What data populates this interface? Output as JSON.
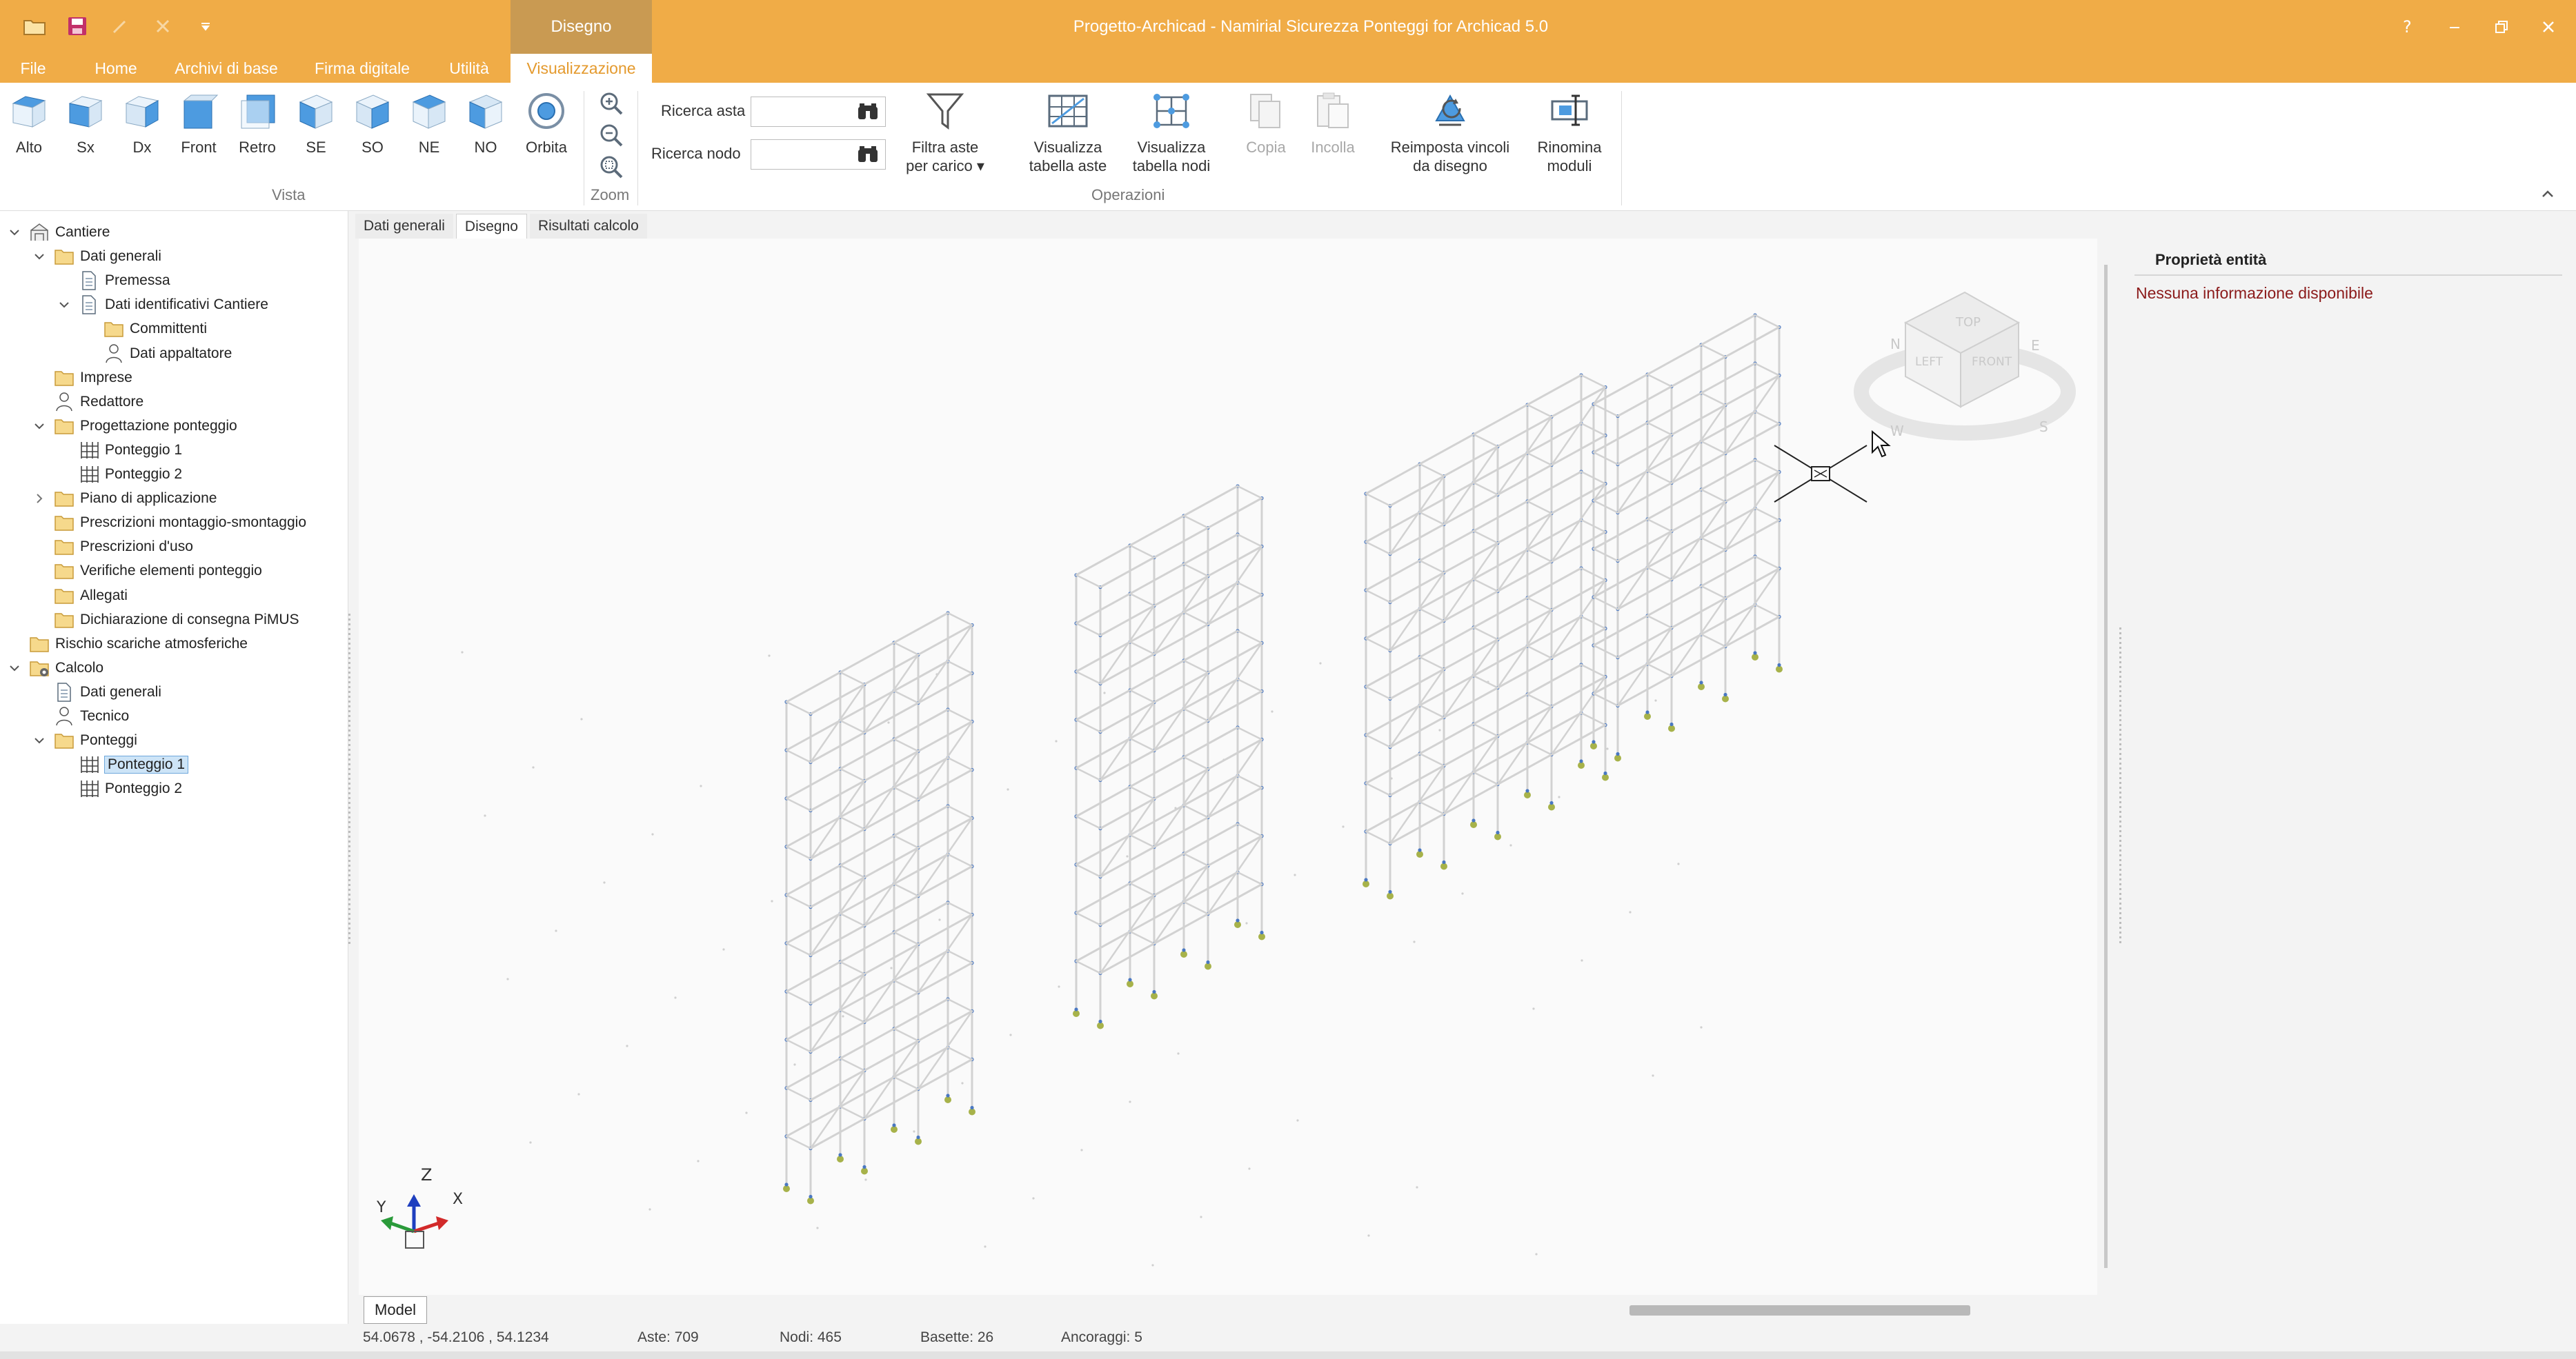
{
  "window": {
    "title": "Progetto-Archicad - Namirial Sicurezza Ponteggi for Archicad 5.0",
    "context_tab": "Disegno",
    "controls": [
      "?",
      "–",
      "❐",
      "✕"
    ]
  },
  "menu": {
    "tabs": [
      {
        "label": "File"
      },
      {
        "label": "Home"
      },
      {
        "label": "Archivi di base"
      },
      {
        "label": "Firma digitale"
      },
      {
        "label": "Utilità"
      },
      {
        "label": "Visualizzazione",
        "active": true
      }
    ]
  },
  "ribbon": {
    "vista": {
      "group_label": "Vista",
      "buttons": [
        "Alto",
        "Sx",
        "Dx",
        "Front",
        "Retro",
        "SE",
        "SO",
        "NE",
        "NO",
        "Orbita"
      ]
    },
    "zoom": {
      "group_label": "Zoom"
    },
    "operazioni": {
      "group_label": "Operazioni",
      "ricerca_asta": "Ricerca asta",
      "ricerca_nodo": "Ricerca nodo",
      "filtra": [
        "Filtra aste",
        "per carico ▾"
      ],
      "vis_aste": [
        "Visualizza",
        "tabella aste"
      ],
      "vis_nodi": [
        "Visualizza",
        "tabella nodi"
      ],
      "copia": "Copia",
      "incolla": "Incolla",
      "reimposta": [
        "Reimposta vincoli",
        "da disegno"
      ],
      "rinomina": [
        "Rinomina",
        "moduli"
      ]
    }
  },
  "tree": {
    "items": [
      {
        "label": "Cantiere",
        "level": 0,
        "expander": "open",
        "icon": "site"
      },
      {
        "label": "Dati generali",
        "level": 1,
        "expander": "open",
        "icon": "folder"
      },
      {
        "label": "Premessa",
        "level": 2,
        "expander": "none",
        "icon": "doc"
      },
      {
        "label": "Dati identificativi Cantiere",
        "level": 2,
        "expander": "open",
        "icon": "doc"
      },
      {
        "label": "Committenti",
        "level": 3,
        "expander": "none",
        "icon": "folder"
      },
      {
        "label": "Dati appaltatore",
        "level": 3,
        "expander": "none",
        "icon": "person"
      },
      {
        "label": "Imprese",
        "level": 1,
        "expander": "none",
        "icon": "folder"
      },
      {
        "label": "Redattore",
        "level": 1,
        "expander": "none",
        "icon": "person"
      },
      {
        "label": "Progettazione ponteggio",
        "level": 1,
        "expander": "open",
        "icon": "folder"
      },
      {
        "label": "Ponteggio 1",
        "level": 2,
        "expander": "none",
        "icon": "scaffold"
      },
      {
        "label": "Ponteggio 2",
        "level": 2,
        "expander": "none",
        "icon": "scaffold"
      },
      {
        "label": "Piano di applicazione",
        "level": 1,
        "expander": "closed",
        "icon": "folder"
      },
      {
        "label": "Prescrizioni montaggio-smontaggio",
        "level": 1,
        "expander": "none",
        "icon": "folder"
      },
      {
        "label": "Prescrizioni d'uso",
        "level": 1,
        "expander": "none",
        "icon": "folder"
      },
      {
        "label": "Verifiche elementi ponteggio",
        "level": 1,
        "expander": "none",
        "icon": "folder"
      },
      {
        "label": "Allegati",
        "level": 1,
        "expander": "none",
        "icon": "folder"
      },
      {
        "label": "Dichiarazione di consegna PiMUS",
        "level": 1,
        "expander": "none",
        "icon": "folder"
      },
      {
        "label": "Rischio scariche atmosferiche",
        "level": 0,
        "expander": "none",
        "icon": "folder"
      },
      {
        "label": "Calcolo",
        "level": 0,
        "expander": "open",
        "icon": "calc"
      },
      {
        "label": "Dati generali",
        "level": 1,
        "expander": "none",
        "icon": "doc"
      },
      {
        "label": "Tecnico",
        "level": 1,
        "expander": "none",
        "icon": "person"
      },
      {
        "label": "Ponteggi",
        "level": 1,
        "expander": "open",
        "icon": "folder"
      },
      {
        "label": "Ponteggio 1",
        "level": 2,
        "expander": "none",
        "icon": "scaffold",
        "selected": true
      },
      {
        "label": "Ponteggio 2",
        "level": 2,
        "expander": "none",
        "icon": "scaffold"
      }
    ]
  },
  "doc_tabs": [
    {
      "label": "Dati generali"
    },
    {
      "label": "Disegno",
      "active": true
    },
    {
      "label": "Risultati calcolo"
    }
  ],
  "viewport": {
    "model_tab": "Model",
    "axis_labels": {
      "z": "Z",
      "x": "X",
      "y": "Y"
    },
    "viewcube": {
      "top": "TOP",
      "left": "LEFT",
      "front": "FRONT",
      "n": "N",
      "e": "E",
      "s": "S",
      "w": "W"
    }
  },
  "properties": {
    "title": "Proprietà entità",
    "message": "Nessuna informazione disponibile"
  },
  "status": {
    "coords": "54.0678 , -54.2106 , 54.1234",
    "aste": "Aste: 709",
    "nodi": "Nodi: 465",
    "basette": "Basette: 26",
    "ancoraggi": "Ancoraggi: 5"
  },
  "colors": {
    "accent": "#f0ac47",
    "context_tab": "#c99a52",
    "active_tab_text": "#e49a2e",
    "selection": "#cde4f7",
    "warning_text": "#8b1a1a",
    "scaffold_line": "#d2d2d2",
    "node": "#4a78c2",
    "base_plate": "#a7b24a"
  }
}
